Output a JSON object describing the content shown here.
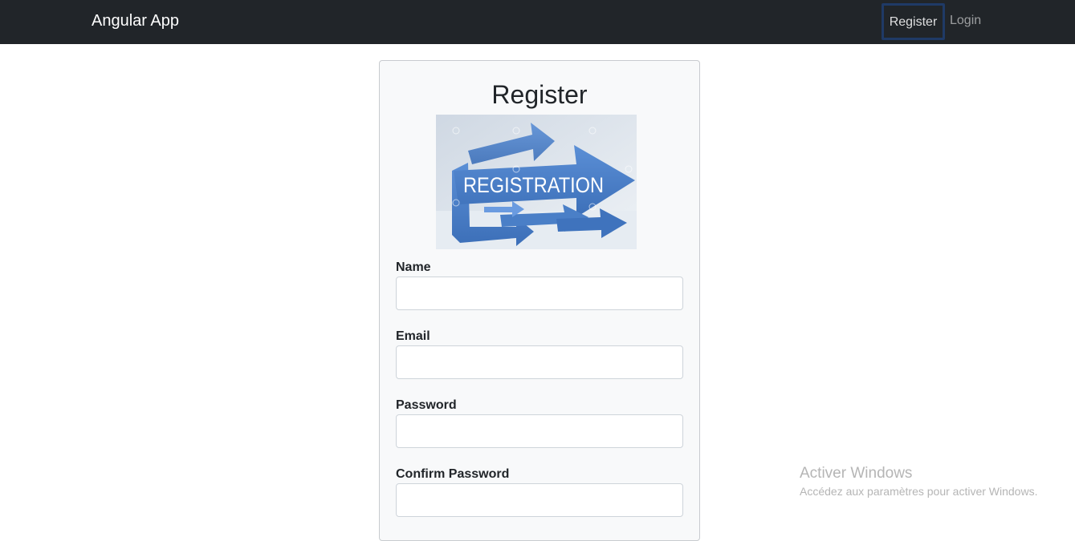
{
  "navbar": {
    "brand": "Angular App",
    "links": {
      "register": "Register",
      "login": "Login"
    },
    "colors": {
      "background": "#212529",
      "active_outline": "#1f3a66"
    }
  },
  "form": {
    "title": "Register",
    "image_text": "REGISTRATION",
    "fields": {
      "name": {
        "label": "Name",
        "value": ""
      },
      "email": {
        "label": "Email",
        "value": ""
      },
      "password": {
        "label": "Password",
        "value": ""
      },
      "confirm_password": {
        "label": "Confirm Password",
        "value": ""
      }
    }
  },
  "watermark": {
    "title": "Activer Windows",
    "subtitle": "Accédez aux paramètres pour activer Windows."
  }
}
